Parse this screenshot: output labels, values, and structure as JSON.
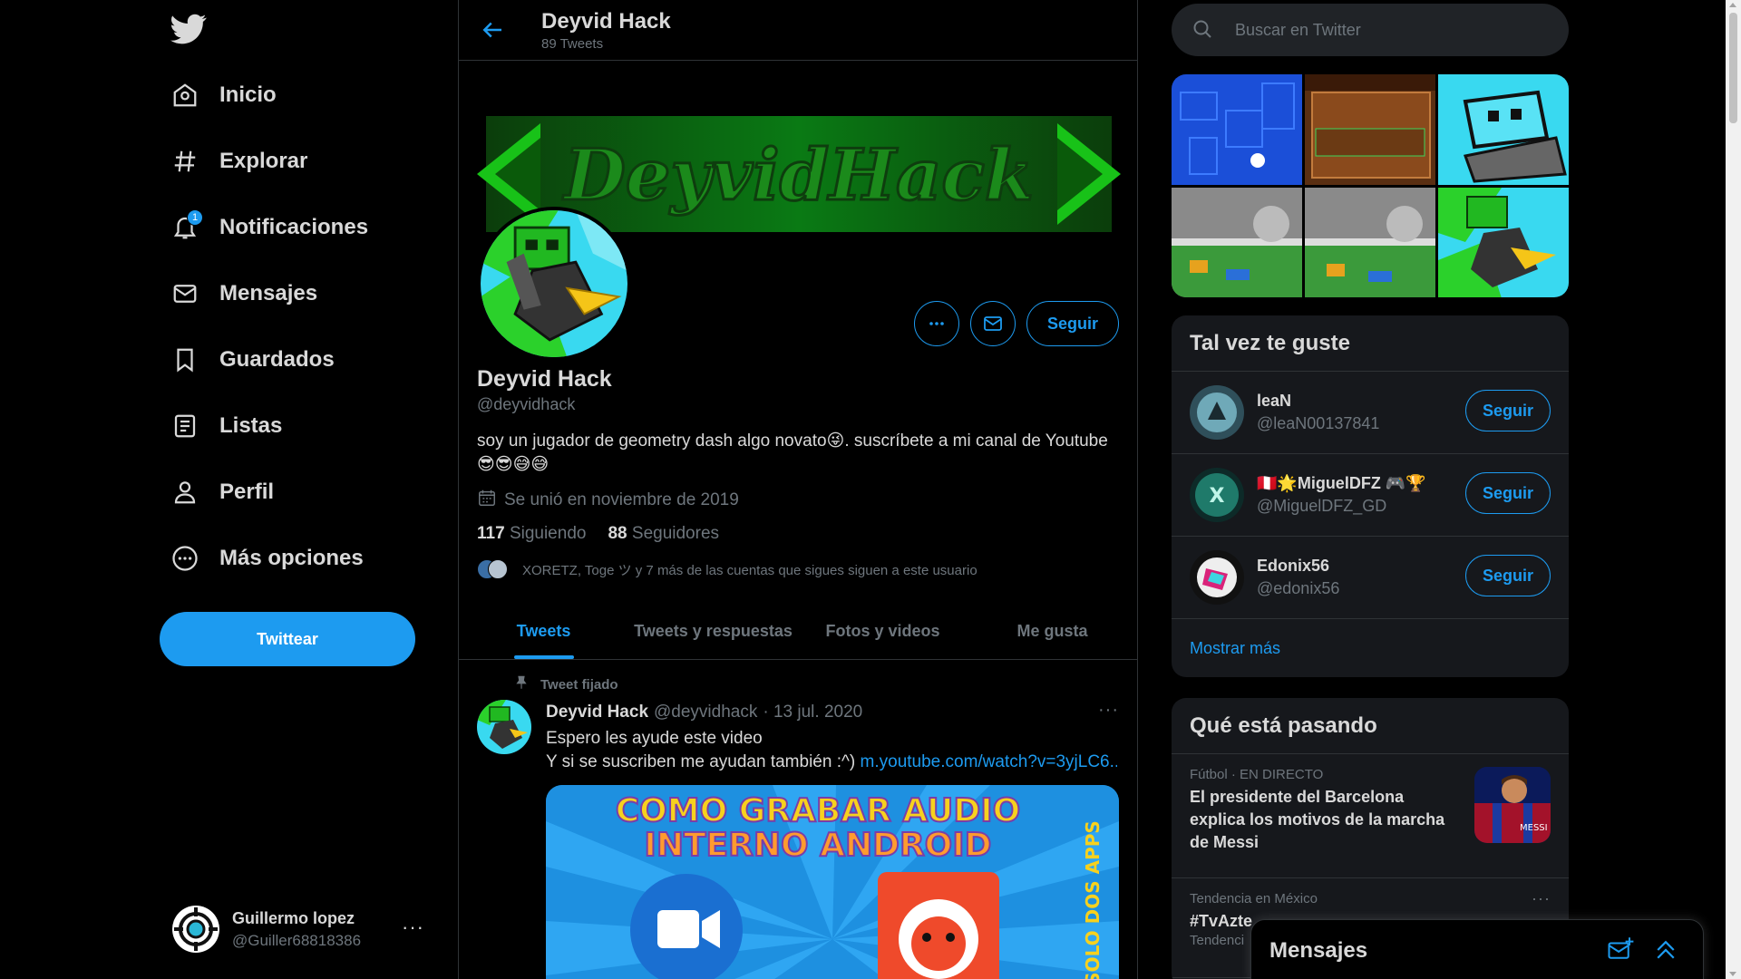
{
  "nav": {
    "items": [
      {
        "label": "Inicio",
        "icon": "home-icon"
      },
      {
        "label": "Explorar",
        "icon": "hashtag-icon"
      },
      {
        "label": "Notificaciones",
        "icon": "bell-icon",
        "badge": "1"
      },
      {
        "label": "Mensajes",
        "icon": "mail-icon"
      },
      {
        "label": "Guardados",
        "icon": "bookmark-icon"
      },
      {
        "label": "Listas",
        "icon": "list-icon"
      },
      {
        "label": "Perfil",
        "icon": "person-icon"
      },
      {
        "label": "Más opciones",
        "icon": "more-circle-icon"
      }
    ],
    "tweet_button": "Twittear"
  },
  "account": {
    "name": "Guillermo lopez",
    "handle": "@Guiller68818386",
    "more": "···"
  },
  "header": {
    "title": "Deyvid Hack",
    "subtitle": "89 Tweets"
  },
  "profile": {
    "banner_text": "DeyvidHack",
    "name": "Deyvid Hack",
    "handle": "@deyvidhack",
    "bio_line1": "soy un jugador de geometry dash algo novato😜. suscríbete a mi canal de Youtube",
    "bio_line2": "😎😎😅😅",
    "joined": "Se unió en noviembre de 2019",
    "following_count": "117",
    "following_label": "Siguiendo",
    "followers_count": "88",
    "followers_label": "Seguidores",
    "mutual": "XORETZ, Toge ツ y 7 más de las cuentas que sigues siguen a este usuario",
    "more_label": "···",
    "follow_label": "Seguir"
  },
  "tabs": [
    "Tweets",
    "Tweets y respuestas",
    "Fotos y videos",
    "Me gusta"
  ],
  "pinned_tweet": {
    "pinned_label": "Tweet fijado",
    "name": "Deyvid Hack",
    "handle": "@deyvidhack",
    "date": "· 13 jul. 2020",
    "line1": "Espero les ayude este video",
    "line2": "Y si se suscriben me ayudan también :^) ",
    "link": "m.youtube.com/watch?v=3yjLC6...",
    "more": "···",
    "media_title1": "COMO GRABAR AUDIO",
    "media_title2": "INTERNO ANDROID",
    "media_side": "SOLO DOS APPS"
  },
  "search": {
    "placeholder": "Buscar en Twitter"
  },
  "suggestions": {
    "title": "Tal vez te guste",
    "items": [
      {
        "name": "leaN",
        "handle": "@leaN00137841",
        "button": "Seguir"
      },
      {
        "name": "🇵🇪🌟MiguelDFZ 🎮🏆",
        "handle": "@MiguelDFZ_GD",
        "button": "Seguir"
      },
      {
        "name": "Edonix56",
        "handle": "@edonix56",
        "button": "Seguir"
      }
    ],
    "show_more": "Mostrar más"
  },
  "trends": {
    "title": "Qué está pasando",
    "items": [
      {
        "meta": "Fútbol · EN DIRECTO",
        "title": "El presidente del Barcelona explica los motivos de la marcha de Messi"
      },
      {
        "meta": "Tendencia en México",
        "title": "#TvAzte",
        "extra": "Tendenci"
      }
    ]
  },
  "messages_drawer": {
    "title": "Mensajes"
  },
  "colors": {
    "accent": "#1d9bf0",
    "background": "#000000",
    "panel": "#16181c",
    "muted": "#6e767d",
    "text": "#d9d9d9"
  }
}
